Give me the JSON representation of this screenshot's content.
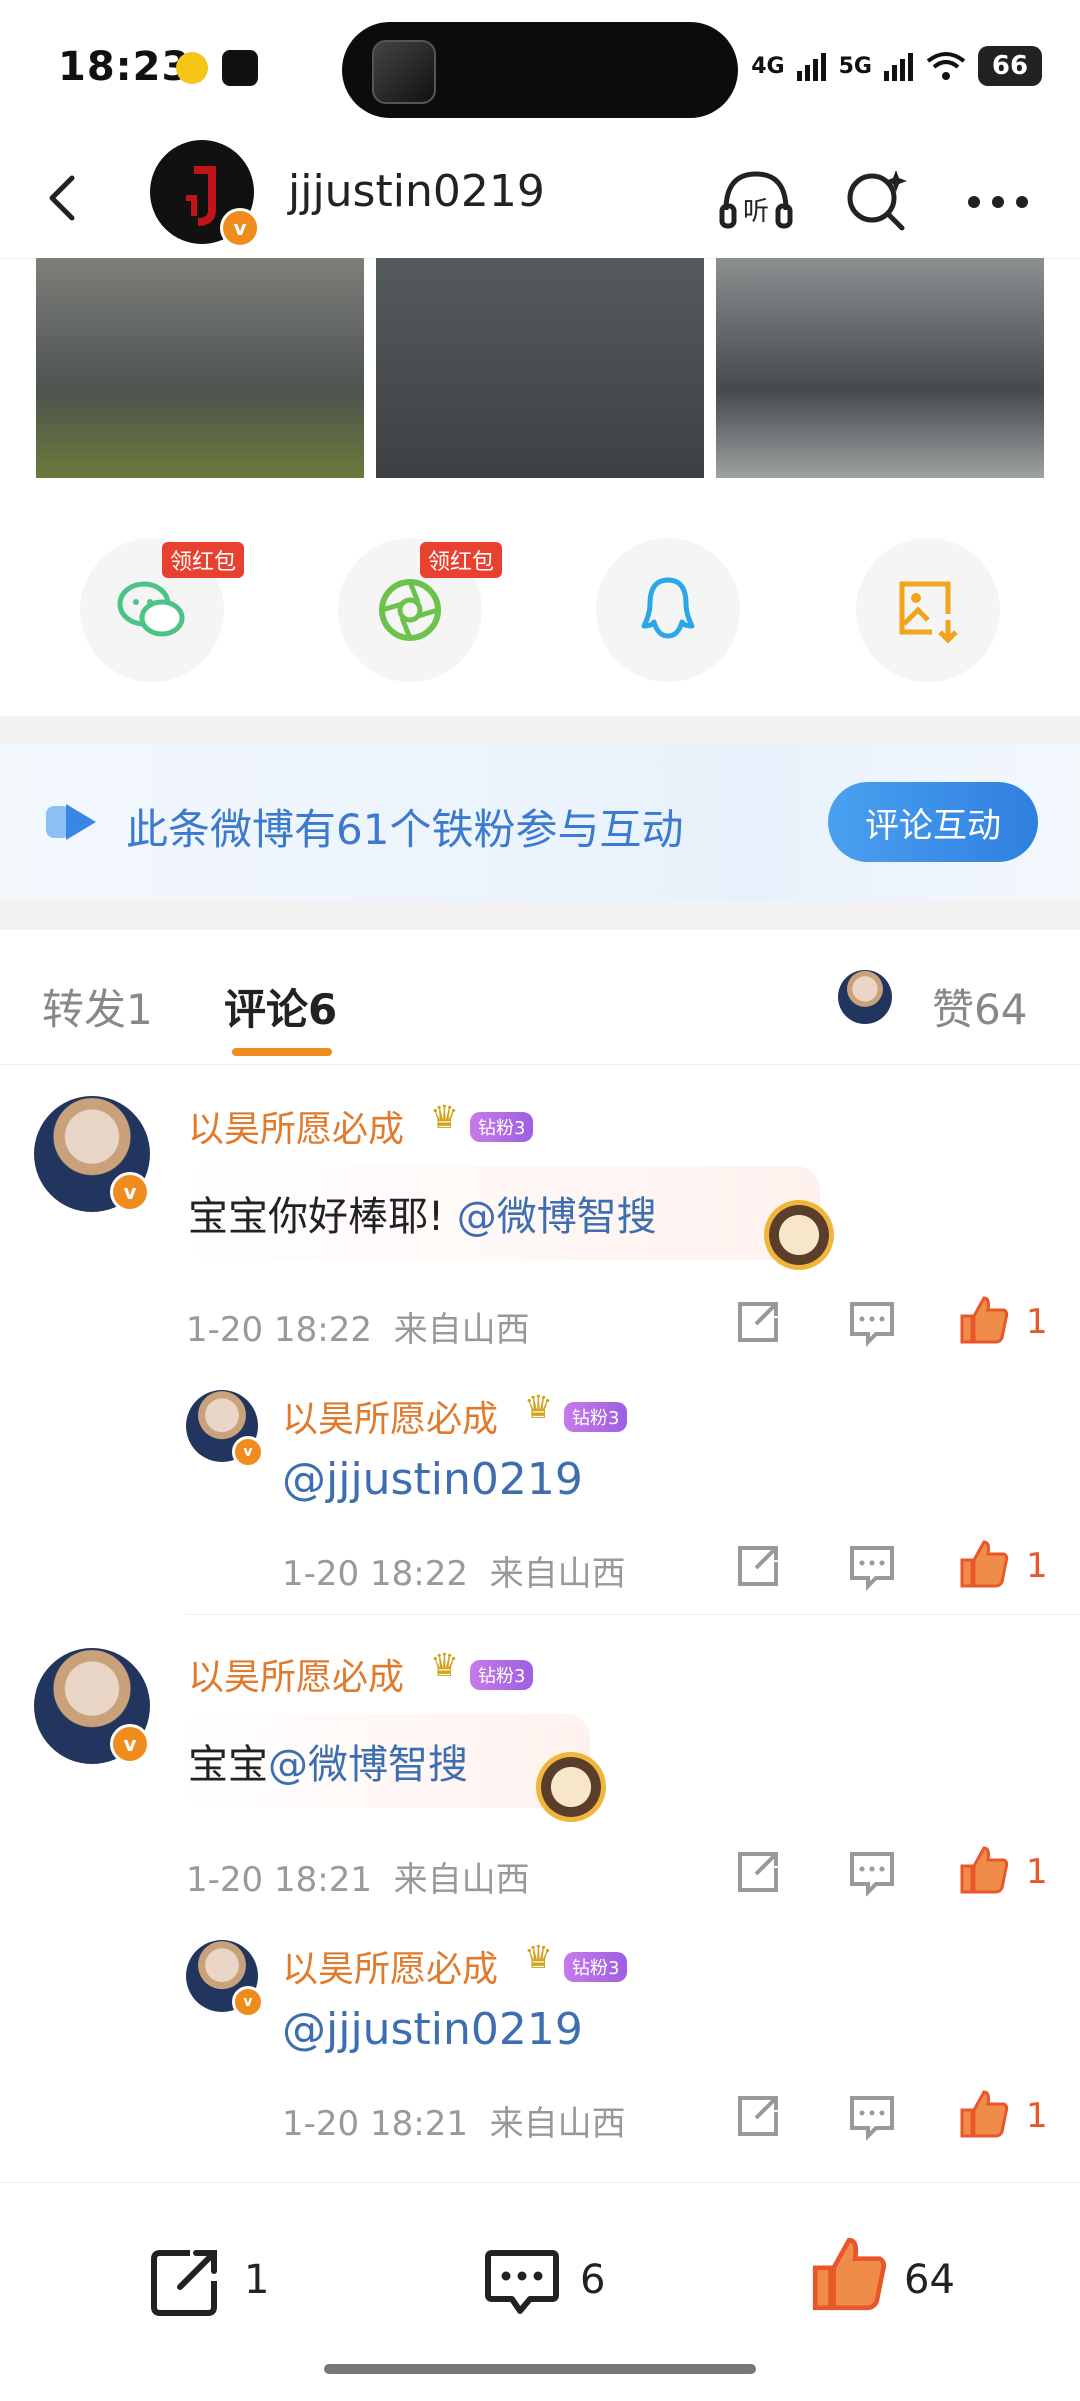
{
  "status_bar": {
    "time": "18:23",
    "signal_4g": "4G",
    "signal_5g": "5G",
    "battery": "66"
  },
  "header": {
    "username": "jjjustin0219",
    "listen_label": "听"
  },
  "share_row": {
    "tags": [
      "领红包",
      "领红包"
    ]
  },
  "fans_banner": {
    "text": "此条微博有61个铁粉参与互动",
    "button": "评论互动"
  },
  "tabs": {
    "repost": "转发",
    "repost_count": "1",
    "comment": "评论",
    "comment_count": "6",
    "likes_label": "赞",
    "likes_count": "64"
  },
  "comments": [
    {
      "name": "以昊所愿必成",
      "fan_badge": "钻粉3",
      "text_prefix": "宝宝你好棒耶! ",
      "mention": "@微博智搜",
      "time": "1-20 18:22",
      "location": "来自山西",
      "likes": "1",
      "reply": {
        "name": "以昊所愿必成",
        "fan_badge": "钻粉3",
        "mention": "@jjjustin0219",
        "time": "1-20 18:22",
        "location": "来自山西",
        "likes": "1"
      }
    },
    {
      "name": "以昊所愿必成",
      "fan_badge": "钻粉3",
      "text_prefix": "宝宝",
      "mention": "@微博智搜",
      "time": "1-20 18:21",
      "location": "来自山西",
      "likes": "1",
      "reply": {
        "name": "以昊所愿必成",
        "fan_badge": "钻粉3",
        "mention": "@jjjustin0219",
        "time": "1-20 18:21",
        "location": "来自山西",
        "likes": "1"
      }
    }
  ],
  "bottom_bar": {
    "repost_count": "1",
    "comment_count": "6",
    "like_count": "64"
  },
  "colors": {
    "accent_orange": "#f08c1e",
    "link_blue": "#3d6fb0",
    "like_orange": "#e8562b"
  }
}
